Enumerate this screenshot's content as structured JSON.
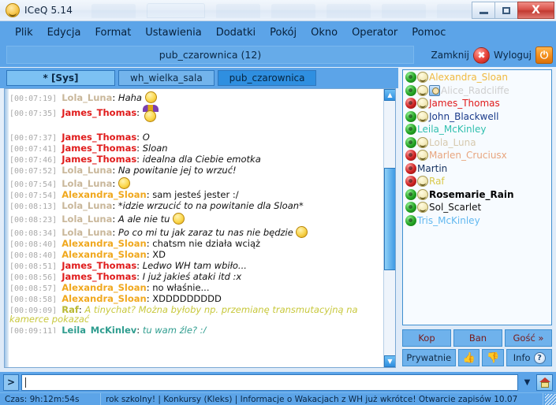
{
  "window": {
    "title": "ICeQ 5.14",
    "app_icon": "smiley-icon",
    "minimize_label": "",
    "maximize_label": "",
    "close_label": "X"
  },
  "menubar": {
    "items": [
      {
        "label": "Plik"
      },
      {
        "label": "Edycja"
      },
      {
        "label": "Format"
      },
      {
        "label": "Ustawienia"
      },
      {
        "label": "Dodatki"
      },
      {
        "label": "Pokój"
      },
      {
        "label": "Okno"
      },
      {
        "label": "Operator"
      },
      {
        "label": "Pomoc"
      }
    ]
  },
  "room_header": {
    "title": "pub_czarownica (12)",
    "close_label": "Zamknij",
    "close_icon": "red-x-circle-icon",
    "close_icon_glyph": "✖",
    "logout_label": "Wyloguj",
    "logout_icon": "power-icon",
    "logout_icon_glyph": "⏻"
  },
  "tabs": [
    {
      "label": "*  [Sys]",
      "active": false,
      "kind": "sys"
    },
    {
      "label": "wh_wielka_sala",
      "active": false,
      "kind": "room"
    },
    {
      "label": "pub_czarownica",
      "active": true,
      "kind": "room"
    }
  ],
  "chat": {
    "messages": [
      {
        "time": "[00:07:19]",
        "nick": "Lola_Luna",
        "nick_class": "nick-lola",
        "text": "Haha ",
        "style": "ital",
        "emote": "dizzy-smiley-icon"
      },
      {
        "time": "[00:07:35]",
        "nick": "James_Thomas",
        "nick_class": "nick-james",
        "text": "",
        "style": "",
        "emote": "jester-smiley-icon",
        "tall": true
      },
      {
        "time": "[00:07:37]",
        "nick": "James_Thomas",
        "nick_class": "nick-james",
        "text": "O",
        "style": "ital",
        "emote": ""
      },
      {
        "time": "[00:07:41]",
        "nick": "James_Thomas",
        "nick_class": "nick-james",
        "text": "Sloan",
        "style": "ital",
        "emote": ""
      },
      {
        "time": "[00:07:46]",
        "nick": "James_Thomas",
        "nick_class": "nick-james",
        "text": "idealna dla Ciebie emotka",
        "style": "ital",
        "emote": ""
      },
      {
        "time": "[00:07:52]",
        "nick": "Lola_Luna",
        "nick_class": "nick-lola",
        "text": "Na powitanie jej to wrzuć!",
        "style": "ital",
        "emote": ""
      },
      {
        "time": "[00:07:54]",
        "nick": "Lola_Luna",
        "nick_class": "nick-lola",
        "text": "",
        "style": "",
        "emote": "laughing-smiley-icon"
      },
      {
        "time": "[00:07:54]",
        "nick": "Alexandra_Sloan",
        "nick_class": "nick-alex",
        "text": "sam jesteś jester :/",
        "style": "",
        "emote": ""
      },
      {
        "time": "[00:08:13]",
        "nick": "Lola_Luna",
        "nick_class": "nick-lola",
        "text": "*idzie wrzucić to na powitanie dla Sloan*",
        "style": "ital",
        "emote": ""
      },
      {
        "time": "[00:08:23]",
        "nick": "Lola_Luna",
        "nick_class": "nick-lola",
        "text": "A ale nie tu ",
        "style": "ital",
        "emote": "laughing-smiley-icon"
      },
      {
        "time": "[00:08:34]",
        "nick": "Lola_Luna",
        "nick_class": "nick-lola",
        "text": "Po co mi tu jak zaraz tu nas nie będzie ",
        "style": "ital",
        "emote": "wink-smiley-icon"
      },
      {
        "time": "[00:08:40]",
        "nick": "Alexandra_Sloan",
        "nick_class": "nick-alex",
        "text": "chatsm nie działa wciąż",
        "style": "",
        "emote": ""
      },
      {
        "time": "[00:08:40]",
        "nick": "Alexandra_Sloan",
        "nick_class": "nick-alex",
        "text": "XD",
        "style": "",
        "emote": ""
      },
      {
        "time": "[00:08:51]",
        "nick": "James_Thomas",
        "nick_class": "nick-james",
        "text": "Ledwo WH tam wbiło...",
        "style": "ital",
        "emote": ""
      },
      {
        "time": "[00:08:56]",
        "nick": "James_Thomas",
        "nick_class": "nick-james",
        "text": "I już jakieś ataki itd :x",
        "style": "ital",
        "emote": ""
      },
      {
        "time": "[00:08:57]",
        "nick": "Alexandra_Sloan",
        "nick_class": "nick-alex",
        "text": "no właśnie...",
        "style": "",
        "emote": ""
      },
      {
        "time": "[00:08:58]",
        "nick": "Alexandra_Sloan",
        "nick_class": "nick-alex",
        "text": "XDDDDDDDDD",
        "style": "",
        "emote": ""
      },
      {
        "time": "[00:09:09]",
        "nick": "Raf",
        "nick_class": "nick-raf",
        "text": "A tinychat? Można byłoby np. przemianę transmutacyjną na kamerce pokazać",
        "style": "raf",
        "emote": "",
        "wrap": true
      },
      {
        "time": "[00:09:11]",
        "nick": "Leila_McKinley",
        "nick_class": "nick-leila",
        "text": "tu wam źle? :/",
        "style": "leila",
        "emote": "",
        "clipped": true
      }
    ],
    "scroll_up_glyph": "▲",
    "scroll_down_glyph": "▼"
  },
  "userlist": {
    "users": [
      {
        "name": "Alexandra_Sloan",
        "name_class": "uname-alex",
        "status": "green",
        "smiley": true,
        "badge": false
      },
      {
        "name": "Alice_Radcliffe",
        "name_class": "uname-alice",
        "status": "green",
        "smiley": true,
        "badge": true
      },
      {
        "name": "James_Thomas",
        "name_class": "uname-james",
        "status": "red",
        "smiley": true,
        "badge": false
      },
      {
        "name": "John_Blackwell",
        "name_class": "uname-john",
        "status": "green",
        "smiley": true,
        "badge": false
      },
      {
        "name": "Leila_McKinley",
        "name_class": "uname-leila",
        "status": "green",
        "smiley": false,
        "badge": false
      },
      {
        "name": "Lola_Luna",
        "name_class": "uname-lola",
        "status": "green",
        "smiley": true,
        "badge": false
      },
      {
        "name": "Marlen_Cruciusx",
        "name_class": "uname-marlen",
        "status": "red",
        "smiley": true,
        "badge": false
      },
      {
        "name": "Martin",
        "name_class": "uname-martin",
        "status": "red",
        "smiley": false,
        "badge": false
      },
      {
        "name": "Raf",
        "name_class": "uname-raf",
        "status": "red",
        "smiley": true,
        "badge": false
      },
      {
        "name": "Rosemarie_Rain",
        "name_class": "uname-rose",
        "status": "green",
        "smiley": true,
        "badge": false
      },
      {
        "name": "Sol_Scarlet",
        "name_class": "uname-sol",
        "status": "green",
        "smiley": true,
        "badge": false
      },
      {
        "name": "Tris_McKinley",
        "name_class": "uname-tris",
        "status": "green",
        "smiley": false,
        "badge": false
      }
    ]
  },
  "action_buttons": {
    "kick": "Kop",
    "ban": "Ban",
    "guest": "Gość »",
    "private": "Prywatnie",
    "thumbs_up_icon": "👍",
    "thumbs_down_icon": "👎",
    "info": "Info",
    "info_icon_glyph": "?"
  },
  "input": {
    "send_button_label": ">",
    "value": "",
    "placeholder": "",
    "history_arrow_glyph": "▼",
    "home_icon": "home-icon"
  },
  "statusbar": {
    "time_label": "Czas: 9h:12m:54s",
    "ticker": "rok szkolny! | Konkursy (Kleks) | Informacje o Wakacjach z WH już wkrótce! Otwarcie zapisów 10.07"
  },
  "colors": {
    "chrome_blue": "#5ca4e8",
    "tab_active": "#2f8fe0",
    "accent_red": "#e01b1b",
    "accent_orange": "#f0a81e",
    "chat_bg": "#ffffff",
    "user_bg": "#f7fbff"
  }
}
